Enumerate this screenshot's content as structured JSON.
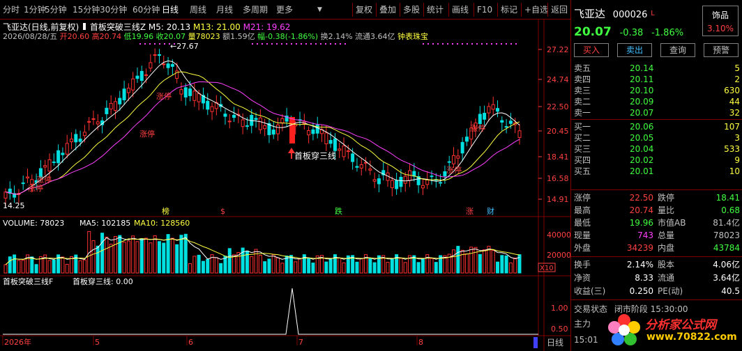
{
  "toolbar": {
    "left_items": [
      "分时",
      "1分钟",
      "5分钟",
      "15分钟",
      "30分钟",
      "60分钟",
      "日线",
      "周线",
      "月线",
      "多周期",
      "更多"
    ],
    "right_items": [
      "复权",
      "叠加",
      "多股",
      "统计",
      "画线",
      "F10",
      "标记",
      "+自选",
      "返回"
    ]
  },
  "info": {
    "name": "飞亚达(日线,前复权)",
    "indicator_name": "首板突破三线Z",
    "ma5": "M5: 20.13",
    "ma13": "M13: 21.00",
    "ma21": "M21: 19.62",
    "date": "2026/08/28/五",
    "open": "开20.60",
    "high": "高20.74",
    "low": "低19.96",
    "close": "收20.07",
    "vol": "量78023",
    "amount": "额1.59亿",
    "change": "幅-0.38(-1.86%)",
    "turnover": "换2.14%",
    "float": "流通3.64亿",
    "sector": "钟表珠宝"
  },
  "price_axis": [
    "27.22",
    "24.74",
    "22.50",
    "20.45",
    "18.41",
    "16.58",
    "14.91"
  ],
  "annotations": {
    "peak": "27.67",
    "low": "14.25",
    "signal": "首板穿三线",
    "limit_up": "涨停",
    "bottom_marks": [
      "榜",
      "$",
      "跌",
      "涨",
      "财"
    ]
  },
  "volume_panel": {
    "header": "VOLUME: 78023",
    "ma5": "MA5: 102185",
    "ma10": "MA10: 128560",
    "axis": [
      "40000",
      "20000"
    ],
    "unit": "X10"
  },
  "indicator_panel": {
    "header": "首板突破三线F",
    "value": "首板穿三线: 0.00",
    "axis": [
      "1.00",
      "0.50"
    ]
  },
  "time_axis": [
    "2026年",
    "5",
    "6",
    "7",
    "8"
  ],
  "period_label": "日线",
  "quote": {
    "name": "飞亚达",
    "code": "000026",
    "mark": "L",
    "badge_top": "饰品",
    "badge_bottom": "3.10%",
    "price": "20.07",
    "change": "-0.38",
    "pct": "-1.86%",
    "buttons": [
      "买入",
      "卖出",
      "查询",
      "预警"
    ],
    "sell": [
      {
        "label": "卖五",
        "price": "20.14",
        "vol": "5"
      },
      {
        "label": "卖四",
        "price": "20.11",
        "vol": "2"
      },
      {
        "label": "卖三",
        "price": "20.10",
        "vol": "630"
      },
      {
        "label": "卖二",
        "price": "20.09",
        "vol": "44"
      },
      {
        "label": "卖一",
        "price": "20.07",
        "vol": "32"
      }
    ],
    "buy": [
      {
        "label": "买一",
        "price": "20.06",
        "vol": "107"
      },
      {
        "label": "买二",
        "price": "20.05",
        "vol": "3"
      },
      {
        "label": "买三",
        "price": "20.04",
        "vol": "533"
      },
      {
        "label": "买四",
        "price": "20.02",
        "vol": "9"
      },
      {
        "label": "买五",
        "price": "20.01",
        "vol": "10"
      }
    ],
    "stats": [
      {
        "l1": "涨停",
        "v1": "22.50",
        "c1": "#ff4040",
        "l2": "跌停",
        "v2": "18.41",
        "c2": "#40ff40"
      },
      {
        "l1": "最高",
        "v1": "20.74",
        "c1": "#ff4040",
        "l2": "量比",
        "v2": "0.68",
        "c2": "#40ff40"
      },
      {
        "l1": "最低",
        "v1": "19.96",
        "c1": "#40ff40",
        "l2": "市值AB",
        "v2": "81.4亿",
        "c2": "#c0c0c0"
      },
      {
        "l1": "现量",
        "v1": "743",
        "c1": "#ff40ff",
        "l2": "总量",
        "v2": "78023",
        "c2": "#c0c0c0"
      },
      {
        "l1": "外盘",
        "v1": "34239",
        "c1": "#ff4040",
        "l2": "内盘",
        "v2": "43784",
        "c2": "#40ff40"
      }
    ],
    "stats2": [
      {
        "l1": "换手",
        "v1": "2.14%",
        "l2": "股本",
        "v2": "4.06亿"
      },
      {
        "l1": "净资",
        "v1": "8.33",
        "l2": "流通",
        "v2": "3.64亿"
      },
      {
        "l1": "收益(三)",
        "v1": "0.250",
        "l2": "PE(动)",
        "v2": "40.5"
      }
    ],
    "trade_status_label": "交易状态",
    "trade_status": "闭市阶段 15:30:00",
    "main_label": "主力",
    "clock": "15:01",
    "watermark": "分析家公式网",
    "watermark_url": "www.70822.com"
  }
}
